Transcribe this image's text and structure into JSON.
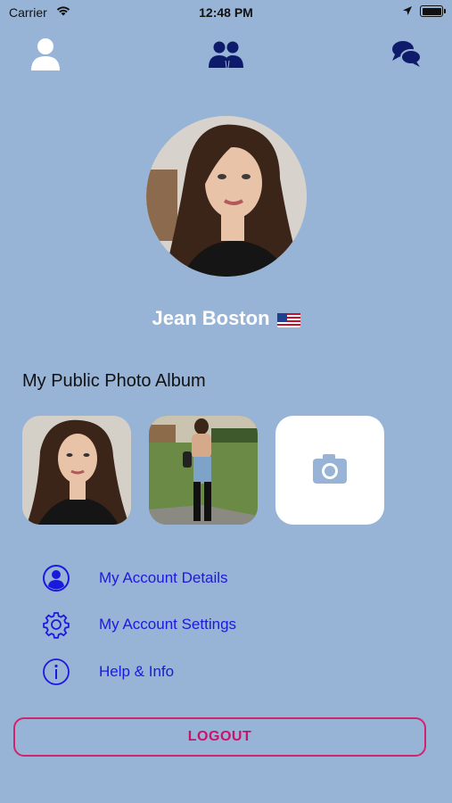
{
  "status_bar": {
    "carrier": "Carrier",
    "time": "12:48 PM",
    "icons": [
      "wifi-icon",
      "location-arrow-icon",
      "battery-icon"
    ]
  },
  "top_nav": {
    "items": [
      {
        "icon": "profile-icon",
        "active": true
      },
      {
        "icon": "friends-icon",
        "active": false
      },
      {
        "icon": "chat-icon",
        "active": false
      }
    ],
    "active_color": "#ffffff",
    "inactive_color": "#0e1b6b"
  },
  "profile": {
    "name": "Jean Boston",
    "flag": "🇺🇸"
  },
  "album": {
    "title": "My Public Photo Album",
    "photos": [
      {
        "kind": "portrait-photo"
      },
      {
        "kind": "full-body-photo"
      },
      {
        "kind": "add-photo",
        "icon": "camera-icon"
      }
    ]
  },
  "menu": {
    "items": [
      {
        "label": "My Account Details",
        "icon": "user-circle-icon"
      },
      {
        "label": "My Account Settings",
        "icon": "gear-icon"
      },
      {
        "label": "Help & Info",
        "icon": "info-circle-icon"
      }
    ]
  },
  "logout": {
    "label": "LOGOUT"
  },
  "colors": {
    "background": "#97b3d6",
    "menu_text": "#1a1adf",
    "logout_accent": "#d0246e"
  }
}
